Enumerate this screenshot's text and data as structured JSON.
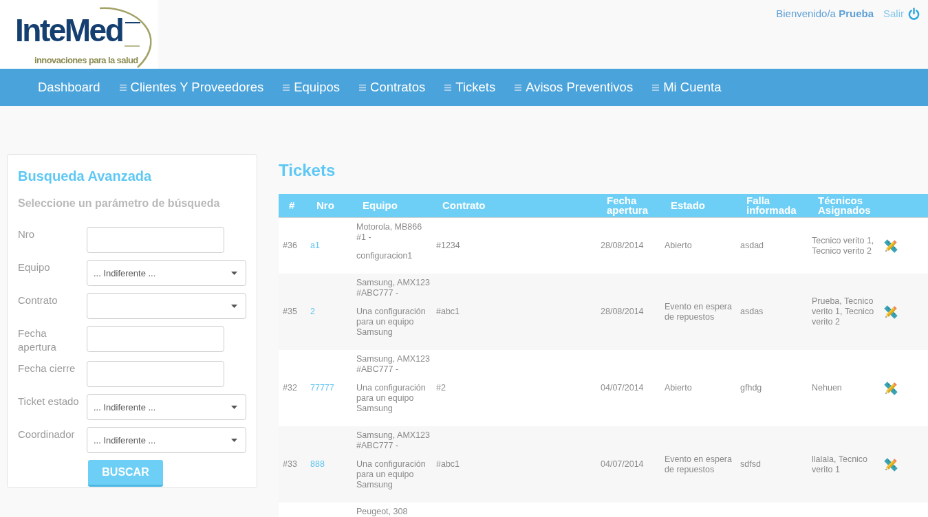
{
  "header": {
    "logo": {
      "name": "InteMed",
      "tagline": "innovaciones para la salud"
    },
    "welcome": "Bienvenido/a **Prueba**",
    "logout": "Salir"
  },
  "nav": [
    {
      "label": "Dashboard",
      "menu_icon": false
    },
    {
      "label": "Clientes Y Proveedores",
      "menu_icon": true
    },
    {
      "label": "Equipos",
      "menu_icon": true
    },
    {
      "label": "Contratos",
      "menu_icon": true
    },
    {
      "label": "Tickets",
      "menu_icon": true
    },
    {
      "label": "Avisos Preventivos",
      "menu_icon": true
    },
    {
      "label": "Mi Cuenta",
      "menu_icon": true
    }
  ],
  "search": {
    "title": "Busqueda Avanzada",
    "subtitle": "Seleccione un parámetro de búsqueda",
    "fields": [
      {
        "label": "Nro",
        "kind": "text"
      },
      {
        "label": "Equipo",
        "kind": "select",
        "value": "... Indiferente ..."
      },
      {
        "label": "Contrato",
        "kind": "select"
      },
      {
        "label": "Fecha apertura",
        "kind": "text"
      },
      {
        "label": "Fecha cierre",
        "kind": "text"
      },
      {
        "label": "Ticket estado",
        "kind": "select",
        "value": "... Indiferente ..."
      },
      {
        "label": "Coordinador",
        "kind": "select",
        "value": "... Indiferente ..."
      }
    ],
    "button": "BUSCAR"
  },
  "tickets": {
    "title": "Tickets",
    "columns": [
      "#",
      "Nro",
      "Equipo",
      "Contrato",
      "Fecha apertura",
      "Estado",
      "Falla informada",
      "Técnicos Asignados"
    ],
    "rows": [
      {
        "numero": "#36",
        "nro": "a1",
        "equipo": "Motorola, MB866 #1 -",
        "configuracion": "configuracion1",
        "contrato": "#1234",
        "fecha_apertura": "28/08/2014",
        "estado": "Abierto",
        "falla": "asdad",
        "tecnicos": "Tecnico verito 1, Tecnico verito 2"
      },
      {
        "numero": "#35",
        "nro": "2",
        "equipo": "Samsung, AMX123 #ABC777 -",
        "configuracion": "Una configuración para un equipo Samsung",
        "contrato": "#abc1",
        "fecha_apertura": "28/08/2014",
        "estado": "Evento en espera de repuestos",
        "falla": "asdas",
        "tecnicos": "Prueba, Tecnico verito 1, Tecnico verito 2"
      },
      {
        "numero": "#32",
        "nro": "77777",
        "equipo": "Samsung, AMX123 #ABC777 -",
        "configuracion": "Una configuración para un equipo Samsung",
        "contrato": "#2",
        "fecha_apertura": "04/07/2014",
        "estado": "Abierto",
        "falla": "gfhdg",
        "tecnicos": "Nehuen"
      },
      {
        "numero": "#33",
        "nro": "888",
        "equipo": "Samsung, AMX123 #ABC777 -",
        "configuracion": "Una configuración para un equipo Samsung",
        "contrato": "#abc1",
        "fecha_apertura": "04/07/2014",
        "estado": "Evento en espera de repuestos",
        "falla": "sdfsd",
        "tecnicos": "llalala, Tecnico verito 1"
      },
      {
        "equipo": "Peugeot, 308"
      }
    ]
  }
}
